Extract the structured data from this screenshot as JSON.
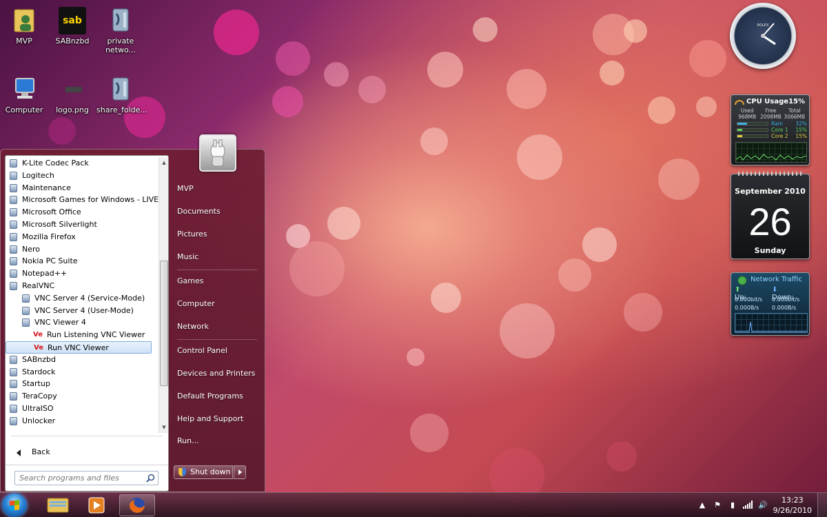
{
  "desktop": {
    "icons": [
      {
        "label": "MVP"
      },
      {
        "label": "SABnzbd"
      },
      {
        "label": "private netwo..."
      },
      {
        "label": "Computer"
      },
      {
        "label": "logo.png"
      },
      {
        "label": "share_folde..."
      }
    ],
    "sab_logo_text": "sab"
  },
  "start_menu": {
    "programs": [
      {
        "label": "K-Lite Codec Pack",
        "level": 0
      },
      {
        "label": "Logitech",
        "level": 0
      },
      {
        "label": "Maintenance",
        "level": 0
      },
      {
        "label": "Microsoft Games for Windows - LIVE",
        "level": 0
      },
      {
        "label": "Microsoft Office",
        "level": 0
      },
      {
        "label": "Microsoft Silverlight",
        "level": 0
      },
      {
        "label": "Mozilla Firefox",
        "level": 0
      },
      {
        "label": "Nero",
        "level": 0
      },
      {
        "label": "Nokia PC Suite",
        "level": 0
      },
      {
        "label": "Notepad++",
        "level": 0
      },
      {
        "label": "RealVNC",
        "level": 0
      },
      {
        "label": "VNC Server 4 (Service-Mode)",
        "level": 1
      },
      {
        "label": "VNC Server 4 (User-Mode)",
        "level": 1
      },
      {
        "label": "VNC Viewer 4",
        "level": 1
      },
      {
        "label": "Run Listening VNC Viewer",
        "level": 2
      },
      {
        "label": "Run VNC Viewer",
        "level": 2,
        "selected": true
      },
      {
        "label": "SABnzbd",
        "level": 0
      },
      {
        "label": "Stardock",
        "level": 0
      },
      {
        "label": "Startup",
        "level": 0
      },
      {
        "label": "TeraCopy",
        "level": 0
      },
      {
        "label": "UltraISO",
        "level": 0
      },
      {
        "label": "Unlocker",
        "level": 0
      }
    ],
    "vnc_icon_text": "Ve",
    "back_label": "Back",
    "search_placeholder": "Search programs and files",
    "right_links": {
      "user": "MVP",
      "documents": "Documents",
      "pictures": "Pictures",
      "music": "Music",
      "games": "Games",
      "computer": "Computer",
      "network": "Network",
      "control_panel": "Control Panel",
      "devices_printers": "Devices and Printers",
      "default_programs": "Default Programs",
      "help_support": "Help and Support",
      "run": "Run..."
    },
    "shutdown_label": "Shut down"
  },
  "gadgets": {
    "clock_brand": "ROLEX",
    "cpu": {
      "title": "CPU Usage",
      "total_pct": "15%",
      "col_labels": [
        "Used",
        "Free",
        "Total"
      ],
      "col_values": [
        "968MB",
        "2098MB",
        "3066MB"
      ],
      "rows": [
        {
          "name": "Ram",
          "value": "32%",
          "fill": 0.32,
          "color": "#3ab0e0"
        },
        {
          "name": "Core 1",
          "value": "15%",
          "fill": 0.15,
          "color": "#5fd35f"
        },
        {
          "name": "Core 2",
          "value": "15%",
          "fill": 0.15,
          "color": "#e0d040"
        }
      ]
    },
    "calendar": {
      "month": "September 2010",
      "day": "26",
      "weekday": "Sunday"
    },
    "network": {
      "title": "Network Traffic",
      "up_label": "Up:",
      "down_label": "Down:",
      "bits_up": "0.000bit/s",
      "bits_down": "0.000bit/s",
      "bytes_up": "0.000B/s",
      "bytes_down": "0.000B/s"
    }
  },
  "taskbar": {
    "time": "13:23",
    "date": "9/26/2010"
  },
  "colors": {
    "accent": "#2a84d8",
    "selection": "#cfe2f7"
  }
}
